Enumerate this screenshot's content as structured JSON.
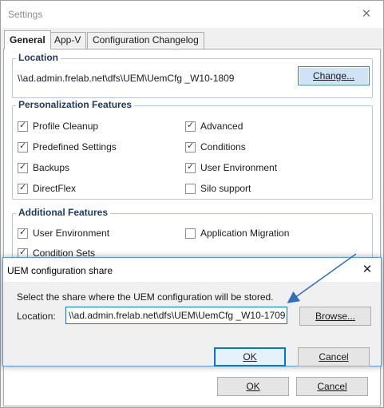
{
  "settings": {
    "title": "Settings",
    "tabs": [
      "General",
      "App-V",
      "Configuration Changelog"
    ],
    "location": {
      "legend": "Location",
      "path": "\\\\ad.admin.frelab.net\\dfs\\UEM\\UemCfg _W10-1809",
      "change_button": "Change..."
    },
    "personalization": {
      "legend": "Personalization Features",
      "left": [
        {
          "label": "Profile Cleanup",
          "checked": true
        },
        {
          "label": "Predefined Settings",
          "checked": true
        },
        {
          "label": "Backups",
          "checked": true
        },
        {
          "label": "DirectFlex",
          "checked": true
        }
      ],
      "right": [
        {
          "label": "Advanced",
          "checked": true
        },
        {
          "label": "Conditions",
          "checked": true
        },
        {
          "label": "User Environment",
          "checked": true
        },
        {
          "label": "Silo support",
          "checked": false
        }
      ]
    },
    "additional": {
      "legend": "Additional Features",
      "items": [
        {
          "label": "User Environment",
          "checked": true
        },
        {
          "label": "Application Migration",
          "checked": false
        },
        {
          "label": "Condition Sets",
          "checked": true
        }
      ]
    },
    "ok_button": "OK",
    "cancel_button": "Cancel"
  },
  "uem_dialog": {
    "title": "UEM configuration share",
    "description": "Select the share where the UEM configuration will be stored.",
    "location_label": "Location:",
    "location_value": "\\\\ad.admin.frelab.net\\dfs\\UEM\\UemCfg _W10-1709",
    "browse_button": "Browse...",
    "ok_button": "OK",
    "cancel_button": "Cancel"
  },
  "colors": {
    "accent": "#0078d7",
    "group_legend": "#1e395b",
    "arrow": "#2f6fbf"
  }
}
